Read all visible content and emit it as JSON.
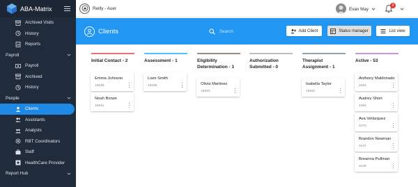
{
  "app": {
    "name": "ABA-Matrix",
    "org": "Reilly - Auer"
  },
  "user": {
    "name": "Evan May",
    "notifications": "9"
  },
  "sidebar": {
    "items": [
      {
        "label": "Archived Visits",
        "type": "item",
        "icon": "archive-icon"
      },
      {
        "label": "History",
        "type": "item",
        "icon": "history-icon"
      },
      {
        "label": "Reports",
        "type": "item",
        "icon": "reports-icon"
      },
      {
        "label": "Payroll",
        "type": "section"
      },
      {
        "label": "Payroll",
        "type": "item",
        "icon": "payroll-icon"
      },
      {
        "label": "Archived",
        "type": "item",
        "icon": "archive-icon"
      },
      {
        "label": "History",
        "type": "item",
        "icon": "history-icon"
      },
      {
        "label": "People",
        "type": "section"
      },
      {
        "label": "Clients",
        "type": "item",
        "icon": "clients-icon",
        "active": true
      },
      {
        "label": "Assistants",
        "type": "item",
        "icon": "assistants-icon"
      },
      {
        "label": "Analysts",
        "type": "item",
        "icon": "analysts-icon"
      },
      {
        "label": "RBT Coordinators",
        "type": "item",
        "icon": "coordinators-icon"
      },
      {
        "label": "Staff",
        "type": "item",
        "icon": "staff-icon"
      },
      {
        "label": "HealthCare Provider",
        "type": "item",
        "icon": "provider-icon"
      },
      {
        "label": "Report Hub",
        "type": "section"
      }
    ]
  },
  "header": {
    "title": "Clients",
    "search_placeholder": "Search",
    "add_client": "Add Client",
    "status_manager": "Status manager",
    "list_view": "List view"
  },
  "colors": {
    "accent": "#2196f3",
    "sidebar": "#202b3c",
    "active": "#1e88e5"
  },
  "board": {
    "columns": [
      {
        "title": "Initial Contact - 2",
        "color": "#e57373",
        "cards": [
          {
            "name": "Emma Johnson",
            "id": "15638"
          },
          {
            "name": "Noah Brown",
            "id": "15641"
          }
        ]
      },
      {
        "title": "Assessment - 1",
        "color": "#4fc3f7",
        "cards": [
          {
            "name": "Liam Smith",
            "id": "15639"
          }
        ]
      },
      {
        "title": "Eligibility Determination - 1",
        "color": "#a1887f",
        "cards": [
          {
            "name": "Olivia Martinez",
            "id": "15640"
          }
        ]
      },
      {
        "title": "Authorization Submitted - 0",
        "color": "#bdbdbd",
        "cards": []
      },
      {
        "title": "Therapist Assignment - 1",
        "color": "#90a4ae",
        "cards": [
          {
            "name": "Isabella Taylor",
            "id": "15642"
          }
        ]
      },
      {
        "title": "Active - 53",
        "color": "#ce93d8",
        "cards": [
          {
            "name": "Anthony Maldonado",
            "id": "4454"
          },
          {
            "name": "Audrey Short",
            "id": "4484"
          },
          {
            "name": "Ava Velázquez",
            "id": "4475"
          },
          {
            "name": "Brandon Newman",
            "id": "4447"
          },
          {
            "name": "Breanna Pullman",
            "id": "4448"
          }
        ]
      }
    ]
  }
}
